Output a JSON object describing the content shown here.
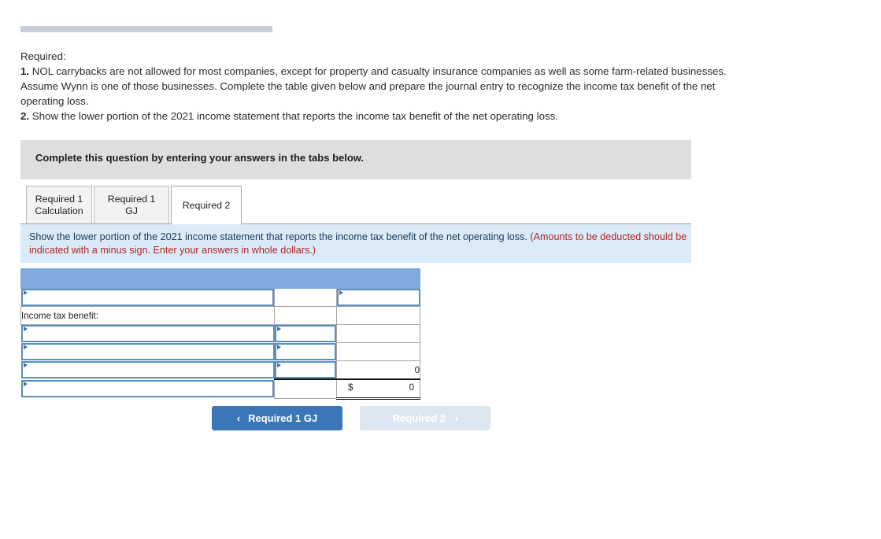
{
  "top_rule": {
    "color": "#c7ced9"
  },
  "required": {
    "heading": "Required:",
    "item1_num": "1.",
    "item1_text": " NOL carrybacks are not allowed for most companies, except for property and casualty insurance companies as well as some farm-related businesses. Assume Wynn is one of those businesses. Complete the table given below and prepare the journal entry to recognize the income tax benefit of the net operating loss.",
    "item2_num": "2.",
    "item2_text": " Show the lower portion of the 2021 income statement that reports the income tax benefit of the net operating loss."
  },
  "banner": {
    "text": "Complete this question by entering your answers in the tabs below.",
    "bg_color": "#dedede"
  },
  "tabs": [
    {
      "label": "Required 1\nCalculation",
      "active": false
    },
    {
      "label": "Required 1 GJ",
      "active": false
    },
    {
      "label": "Required 2",
      "active": true
    }
  ],
  "instruction": {
    "black_part": "Show the lower portion of the 2021 income statement that reports the income tax benefit of the net operating loss. ",
    "red_part": "(Amounts to be deducted should be indicated with a minus sign. Enter your answers in whole dollars.)",
    "bg_color": "#daebf7",
    "red_color": "#b32424"
  },
  "table": {
    "header_color": "#7eaadd",
    "header_label": "",
    "rows": [
      {
        "type": "input-input",
        "label": "",
        "mid": "",
        "right": ""
      },
      {
        "type": "text-plain",
        "label": "Income tax benefit:",
        "mid": "",
        "right": ""
      },
      {
        "type": "input-input",
        "label": "",
        "mid": "",
        "right": ""
      },
      {
        "type": "input-input",
        "label": "",
        "mid": "",
        "right": ""
      },
      {
        "type": "input-value",
        "label": "",
        "mid": "",
        "right": "0"
      },
      {
        "type": "input-dollar",
        "label": "",
        "mid": "",
        "right": "0",
        "dollar": "$"
      }
    ]
  },
  "nav": {
    "prev_label": "Required 1 GJ",
    "prev_icon": "chevron-left-icon",
    "prev_chevron": "‹",
    "next_label": "Required 2",
    "next_icon": "chevron-right-icon",
    "next_chevron": "›",
    "prev_color": "#3b77b8",
    "next_color": "#dce7f2"
  }
}
